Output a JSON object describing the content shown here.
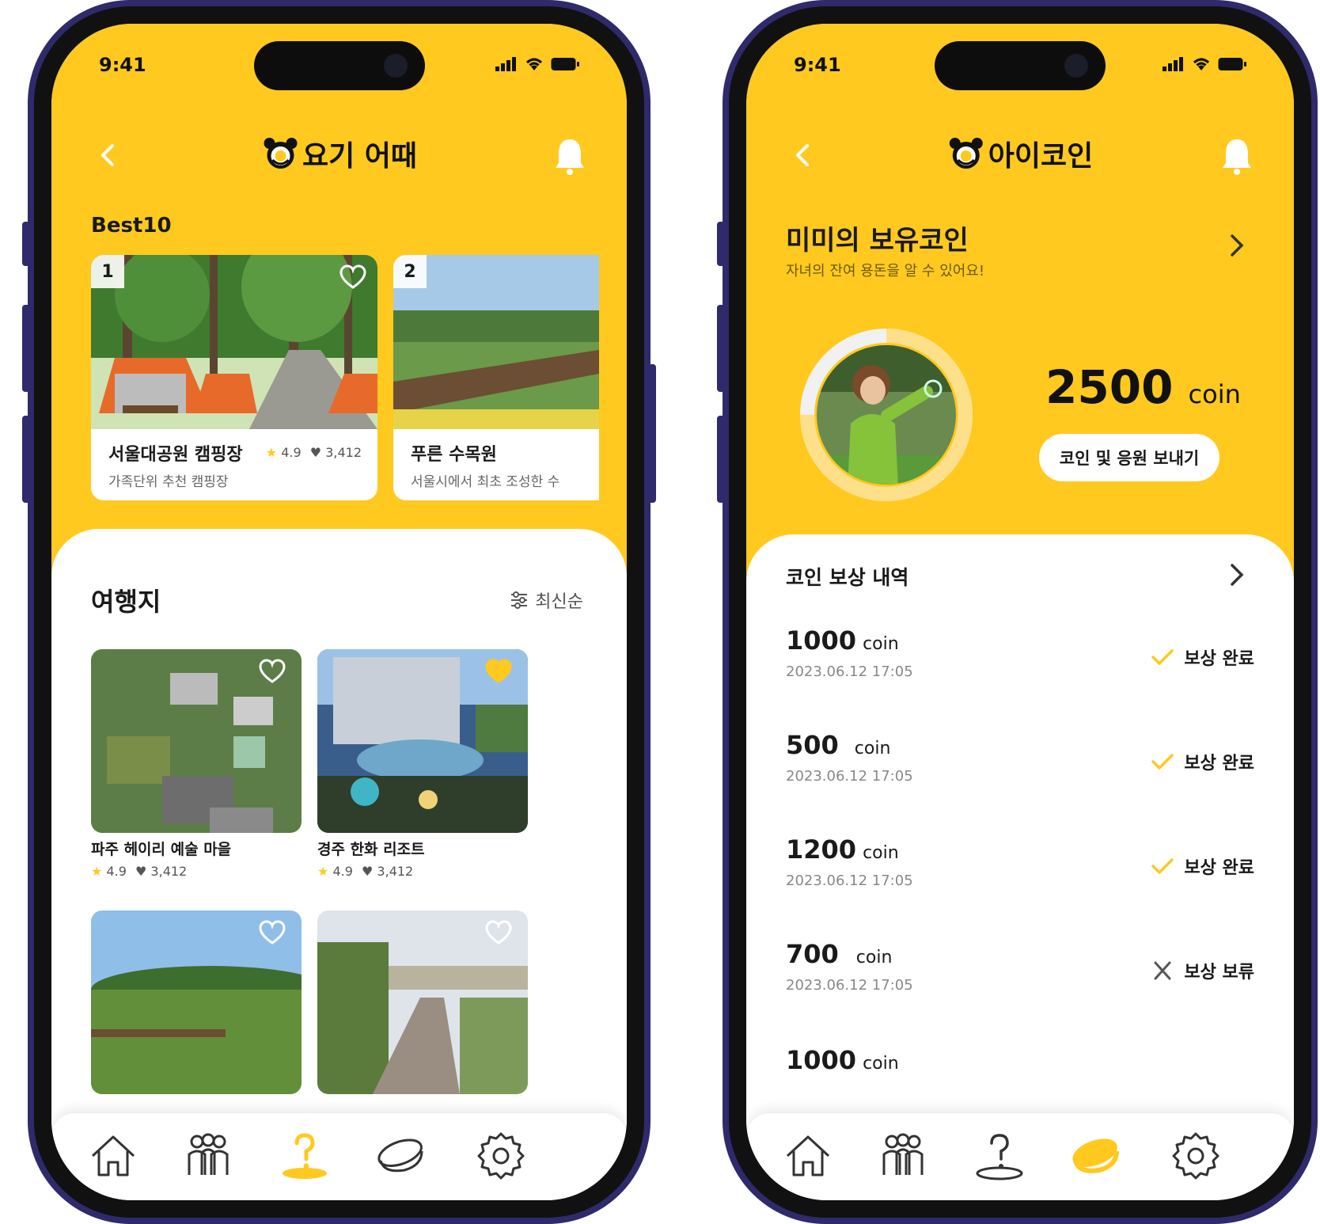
{
  "colors": {
    "brand_yellow": "#FFC91F",
    "phone_frame": "#2E2A6B",
    "accent_check": "#FFC91F"
  },
  "left_phone": {
    "status": {
      "time": "9:41"
    },
    "header": {
      "title": "요기 어때",
      "logo_icon": "bear-logo-icon"
    },
    "best": {
      "label": "Best10",
      "items": [
        {
          "rank": "1",
          "name": "서울대공원 캠핑장",
          "subtitle": "가족단위 추천 캠핑장",
          "rating": "4.9",
          "likes": "3,412"
        },
        {
          "rank": "2",
          "name": "푸른 수목원",
          "subtitle": "서울시에서 최초 조성한 수"
        }
      ]
    },
    "destinations": {
      "title": "여행지",
      "sort_label": "최신순",
      "items": [
        {
          "name": "파주 헤이리 예술 마을",
          "rating": "4.9",
          "likes": "3,412",
          "liked": false
        },
        {
          "name": "경주 한화 리조트",
          "rating": "4.9",
          "likes": "3,412",
          "liked": true
        },
        {
          "name": "",
          "liked": false
        },
        {
          "name": "",
          "liked": false
        }
      ]
    },
    "tabs": [
      "home-icon",
      "family-icon",
      "question-pin-icon",
      "coin-icon",
      "gear-icon"
    ],
    "active_tab": "question-pin-icon"
  },
  "right_phone": {
    "status": {
      "time": "9:41"
    },
    "header": {
      "title": "아이코인",
      "logo_icon": "bear-logo-icon"
    },
    "owner": {
      "title": "미미의 보유코인",
      "subtitle": "자녀의 잔여 용돈을 알 수 있어요!"
    },
    "balance": {
      "amount": "2500",
      "unit": "coin",
      "ring_fraction": 0.75
    },
    "send_button": "코인 및 응원 보내기",
    "rewards": {
      "title": "코인 보상 내역",
      "items": [
        {
          "amount": "1000",
          "unit": "coin",
          "date": "2023.06.12 17:05",
          "status": "보상 완료",
          "icon": "check-icon"
        },
        {
          "amount": "500",
          "unit": "coin",
          "date": "2023.06.12 17:05",
          "status": "보상 완료",
          "icon": "check-icon"
        },
        {
          "amount": "1200",
          "unit": "coin",
          "date": "2023.06.12 17:05",
          "status": "보상 완료",
          "icon": "check-icon"
        },
        {
          "amount": "700",
          "unit": "coin",
          "date": "2023.06.12 17:05",
          "status": "보상 보류",
          "icon": "close-icon"
        },
        {
          "amount": "1000",
          "unit": "coin"
        }
      ]
    },
    "tabs": [
      "home-icon",
      "family-icon",
      "question-pin-icon",
      "coin-icon",
      "gear-icon"
    ],
    "active_tab": "coin-icon"
  }
}
